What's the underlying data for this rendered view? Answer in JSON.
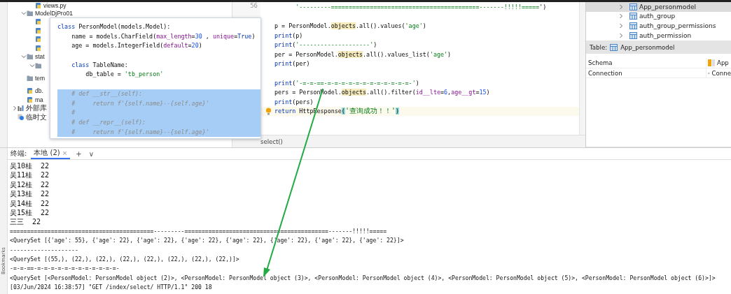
{
  "project_tree": [
    {
      "kind": "file",
      "label": "views.py"
    },
    {
      "kind": "folder",
      "label": "ModelDjPro01",
      "expanded": true,
      "children": [
        {
          "kind": "file"
        },
        {
          "kind": "file"
        },
        {
          "kind": "file"
        },
        {
          "kind": "file"
        }
      ]
    },
    {
      "kind": "folder",
      "label": "stat",
      "expanded": true,
      "children": [
        {
          "kind": "folder",
          "expanded": true
        }
      ]
    },
    {
      "kind": "folder",
      "label": "tem"
    },
    {
      "kind": "file",
      "label": "db."
    },
    {
      "kind": "file",
      "label": "ma"
    },
    {
      "kind": "library",
      "label": "外部库",
      "expanded": false
    },
    {
      "kind": "scratch",
      "label": "临时文"
    }
  ],
  "side_strip": {
    "label": "Bookmarks"
  },
  "popup": {
    "lines": [
      {
        "selected": false,
        "spans": [
          {
            "kind": "kw",
            "text": "class"
          },
          {
            "kind": "plain",
            "text": " PersonModel(models.Model):"
          }
        ]
      },
      {
        "selected": false,
        "spans": [
          {
            "kind": "plain",
            "text": "    name = models.CharField("
          },
          {
            "kind": "param",
            "text": "max_length"
          },
          {
            "kind": "plain",
            "text": "="
          },
          {
            "kind": "num",
            "text": "30"
          },
          {
            "kind": "plain",
            "text": " , "
          },
          {
            "kind": "param",
            "text": "unique"
          },
          {
            "kind": "plain",
            "text": "="
          },
          {
            "kind": "kw",
            "text": "True"
          },
          {
            "kind": "plain",
            "text": ")"
          }
        ]
      },
      {
        "selected": false,
        "spans": [
          {
            "kind": "plain",
            "text": "    age = models.IntegerField("
          },
          {
            "kind": "param",
            "text": "default"
          },
          {
            "kind": "plain",
            "text": "="
          },
          {
            "kind": "num",
            "text": "20"
          },
          {
            "kind": "plain",
            "text": ")"
          }
        ]
      },
      {
        "selected": false
      },
      {
        "selected": false,
        "spans": [
          {
            "kind": "kw",
            "text": "    class"
          },
          {
            "kind": "plain",
            "text": " TableName:"
          }
        ]
      },
      {
        "selected": false,
        "spans": [
          {
            "kind": "plain",
            "text": "        db_table = "
          },
          {
            "kind": "str",
            "text": "'tb_person'"
          }
        ]
      },
      {
        "selected": false
      },
      {
        "selected": true,
        "spans": [
          {
            "kind": "comment",
            "text": "    # def __str__(self):"
          }
        ]
      },
      {
        "selected": true,
        "spans": [
          {
            "kind": "comment",
            "text": "    #     return f'{self.name}--{self.age}'"
          }
        ]
      },
      {
        "selected": true,
        "spans": [
          {
            "kind": "comment",
            "text": "    #"
          }
        ]
      },
      {
        "selected": true,
        "spans": [
          {
            "kind": "comment",
            "text": "    # def __repr__(self):"
          }
        ]
      },
      {
        "selected": true,
        "spans": [
          {
            "kind": "comment",
            "text": "    #     return f'{self.name}--{self.age}'"
          }
        ]
      }
    ]
  },
  "editor": {
    "line_number": "56",
    "lines": [
      {
        "current": false,
        "spans": [
          {
            "kind": "str",
            "text": "      '---------==========================================-------!!!!!====="
          },
          {
            "kind": "plain",
            "text": "')"
          }
        ]
      },
      {
        "current": false
      },
      {
        "current": false,
        "spans": [
          {
            "kind": "plain",
            "text": "p = PersonModel."
          },
          {
            "kind": "hl",
            "text": "objects"
          },
          {
            "kind": "plain",
            "text": ".all().values("
          },
          {
            "kind": "str",
            "text": "'age'"
          },
          {
            "kind": "plain",
            "text": ")"
          }
        ]
      },
      {
        "current": false,
        "spans": [
          {
            "kind": "kw",
            "text": "print"
          },
          {
            "kind": "plain",
            "text": "(p)"
          }
        ]
      },
      {
        "current": false,
        "spans": [
          {
            "kind": "kw",
            "text": "print"
          },
          {
            "kind": "plain",
            "text": "("
          },
          {
            "kind": "str",
            "text": "'--------------------'"
          },
          {
            "kind": "plain",
            "text": ")"
          }
        ]
      },
      {
        "current": false,
        "spans": [
          {
            "kind": "plain",
            "text": "per = PersonModel."
          },
          {
            "kind": "hl",
            "text": "objects"
          },
          {
            "kind": "plain",
            "text": ".all().values_list("
          },
          {
            "kind": "str",
            "text": "'age'"
          },
          {
            "kind": "plain",
            "text": ")"
          }
        ]
      },
      {
        "current": false,
        "spans": [
          {
            "kind": "kw",
            "text": "print"
          },
          {
            "kind": "plain",
            "text": "(per)"
          }
        ]
      },
      {
        "current": false
      },
      {
        "current": false,
        "spans": [
          {
            "kind": "kw",
            "text": "print"
          },
          {
            "kind": "plain",
            "text": "("
          },
          {
            "kind": "str",
            "text": "'-=-=-==-=-=-=-=-=-=-=-=-=-=-=-=-'"
          },
          {
            "kind": "plain",
            "text": ")"
          }
        ]
      },
      {
        "current": false,
        "spans": [
          {
            "kind": "plain",
            "text": "pers = PersonModel."
          },
          {
            "kind": "hl",
            "text": "objects"
          },
          {
            "kind": "plain",
            "text": ".all().filter("
          },
          {
            "kind": "param",
            "text": "id__lte"
          },
          {
            "kind": "plain",
            "text": "="
          },
          {
            "kind": "num",
            "text": "6"
          },
          {
            "kind": "plain",
            "text": ","
          },
          {
            "kind": "param",
            "text": "age__gt"
          },
          {
            "kind": "plain",
            "text": "="
          },
          {
            "kind": "num",
            "text": "15"
          },
          {
            "kind": "plain",
            "text": ")"
          }
        ]
      },
      {
        "current": false,
        "spans": [
          {
            "kind": "kw",
            "text": "print"
          },
          {
            "kind": "plain",
            "text": "(pers)"
          }
        ]
      },
      {
        "current": true,
        "bulb": true,
        "spans": [
          {
            "kind": "kw",
            "text": "return"
          },
          {
            "kind": "plain",
            "text": " HttpResponse"
          },
          {
            "kind": "brace",
            "text": "("
          },
          {
            "kind": "str",
            "text": "'查询成功！！'"
          },
          {
            "kind": "brace",
            "text": ")"
          }
        ]
      }
    ],
    "breadcrumb": "select()"
  },
  "db_tree": [
    {
      "label": "App_personmodel",
      "selected": true
    },
    {
      "label": "auth_group",
      "selected": false
    },
    {
      "label": "auth_group_permissions",
      "selected": false
    },
    {
      "label": "auth_permission",
      "selected": false
    }
  ],
  "table_info": {
    "label": "Table:",
    "name": "App_personmodel",
    "rows": [
      {
        "key": "Schema",
        "value": "App",
        "kind": "schema"
      },
      {
        "key": "Connection",
        "value": "Conne",
        "kind": "connection"
      }
    ]
  },
  "terminal": {
    "label": "终端:",
    "tabs": [
      {
        "label": "本地 (2)",
        "selected": true,
        "close": "×"
      }
    ],
    "add": "+",
    "more": "∨",
    "lines": [
      "吴10桂  22",
      "吴11桂  22",
      "吴12桂  22",
      "吴13桂  22",
      "吴14桂  22",
      "吴15桂  22",
      "三三  22",
      "==========================================---------==========================================-------!!!!!=====",
      "<QuerySet [{'age': 55}, {'age': 22}, {'age': 22}, {'age': 22}, {'age': 22}, {'age': 22}, {'age': 22}, {'age': 22}]>",
      "--------------------",
      "<QuerySet [(55,), (22,), (22,), (22,), (22,), (22,), (22,), (22,)]>",
      "-=-=-==-=-=-=-=-=-=-=-=-=-=-=-=-",
      "<QuerySet [<PersonModel: PersonModel object (2)>, <PersonModel: PersonModel object (3)>, <PersonModel: PersonModel object (4)>, <PersonModel: PersonModel object (5)>, <PersonModel: PersonModel object (6)>]>",
      "[03/Jun/2024 16:38:57] \"GET /index/select/ HTTP/1.1\" 200 18"
    ]
  },
  "annotation": {
    "kind": "arrow"
  }
}
